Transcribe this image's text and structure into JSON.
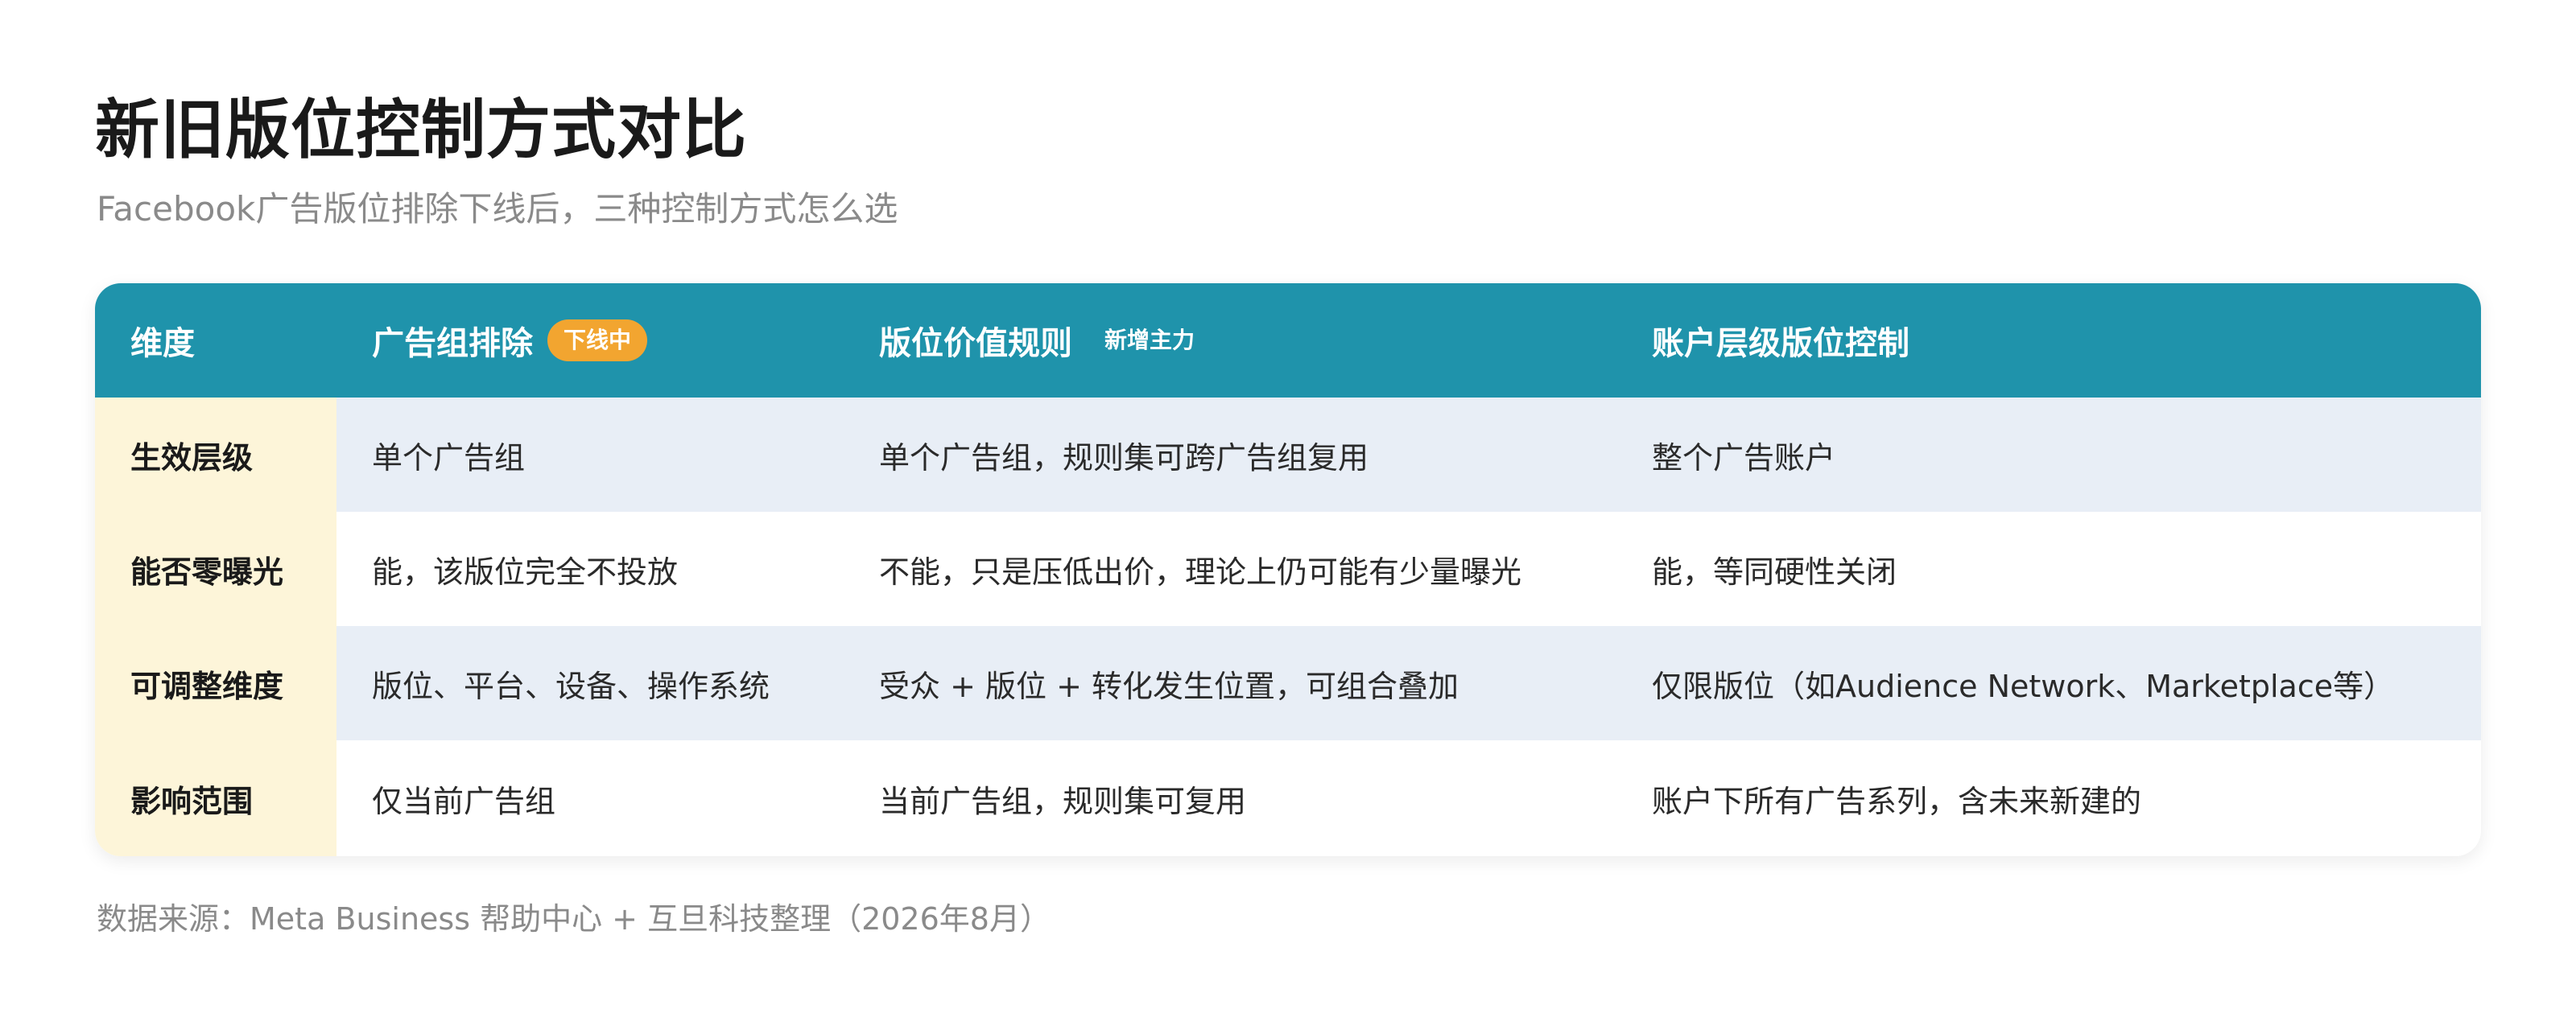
{
  "title": "新旧版位控制方式对比",
  "subtitle": "Facebook广告版位排除下线后，三种控制方式怎么选",
  "table": {
    "headers": [
      {
        "label": "维度",
        "badge": ""
      },
      {
        "label": "广告组排除",
        "badge": "下线中"
      },
      {
        "label": "版位价值规则",
        "badge": "新增主力"
      },
      {
        "label": "账户层级版位控制",
        "badge": ""
      }
    ],
    "rows": [
      {
        "dimension": "生效层级",
        "cells": [
          "单个广告组",
          "单个广告组，规则集可跨广告组复用",
          "整个广告账户"
        ]
      },
      {
        "dimension": "能否零曝光",
        "cells": [
          "能，该版位完全不投放",
          "不能，只是压低出价，理论上仍可能有少量曝光",
          "能，等同硬性关闭"
        ]
      },
      {
        "dimension": "可调整维度",
        "cells": [
          "版位、平台、设备、操作系统",
          "受众 + 版位 + 转化发生位置，可组合叠加",
          "仅限版位（如Audience Network、Marketplace等）"
        ]
      },
      {
        "dimension": "影响范围",
        "cells": [
          "仅当前广告组",
          "当前广告组，规则集可复用",
          "账户下所有广告系列，含未来新建的"
        ]
      }
    ]
  },
  "footer": "数据来源：Meta Business 帮助中心 + 互旦科技整理（2026年8月）",
  "colors": {
    "header_bg": "#1f93ab",
    "row_alt_bg": "#e8eef6",
    "dimension_bg": "#fdf5d9",
    "badge_offline": "#f2a530"
  }
}
